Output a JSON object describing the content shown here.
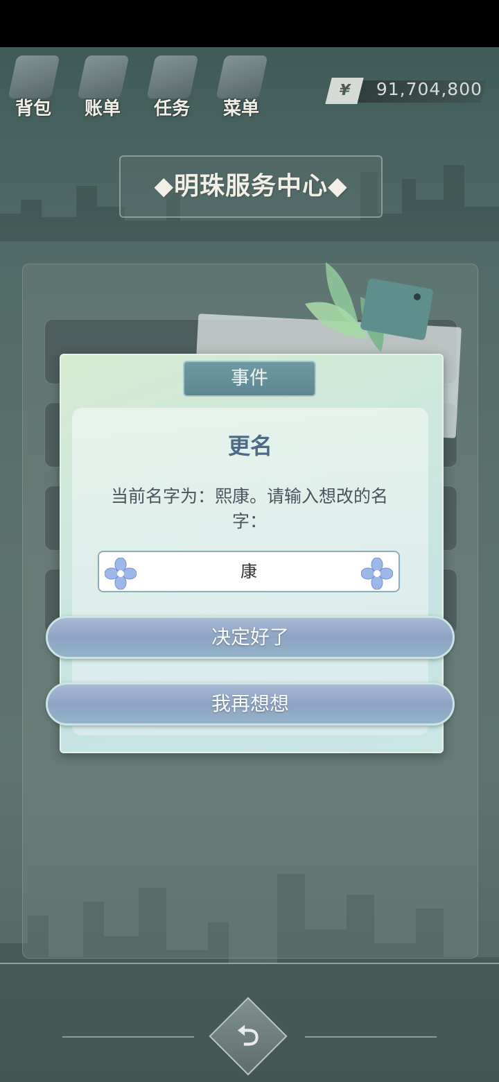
{
  "menu": {
    "items": [
      {
        "label": "背包",
        "icon": "bag-icon"
      },
      {
        "label": "账单",
        "icon": "bill-icon"
      },
      {
        "label": "任务",
        "icon": "task-icon"
      },
      {
        "label": "菜单",
        "icon": "menu-icon"
      }
    ]
  },
  "money": {
    "symbol": "¥",
    "value": "91,704,800"
  },
  "page": {
    "title": "◆明珠服务中心◆"
  },
  "dialog": {
    "header": "事件",
    "title": "更名",
    "prompt": "当前名字为：熙康。请输入想改的名字：",
    "input_value": "康",
    "confirm_label": "决定好了",
    "cancel_label": "我再想想"
  },
  "footer": {
    "back_icon": "return-icon"
  }
}
